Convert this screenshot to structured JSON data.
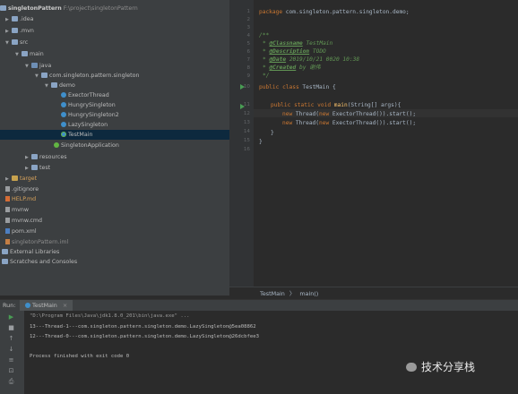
{
  "project_tree": {
    "root_name": "singletonPattern",
    "root_path": "F:\\project\\singletonPattern",
    "items": [
      {
        "label": ".idea",
        "icon": "folder-icon"
      },
      {
        "label": ".mvn",
        "icon": "folder-icon"
      },
      {
        "label": "src",
        "icon": "folder-icon"
      },
      {
        "label": "main",
        "icon": "folder-icon"
      },
      {
        "label": "java",
        "icon": "source-folder-icon"
      },
      {
        "label": "com.singleton.pattern.singleton",
        "icon": "package-icon"
      },
      {
        "label": "demo",
        "icon": "package-icon"
      },
      {
        "label": "ExectorThread",
        "icon": "class-icon"
      },
      {
        "label": "HungrySingleton",
        "icon": "class-icon"
      },
      {
        "label": "HungrySingleton2",
        "icon": "class-icon"
      },
      {
        "label": "LazySingleton",
        "icon": "class-icon"
      },
      {
        "label": "TestMain",
        "icon": "class-icon"
      },
      {
        "label": "SingletonApplication",
        "icon": "spring-class-icon"
      },
      {
        "label": "resources",
        "icon": "folder-icon"
      },
      {
        "label": "test",
        "icon": "folder-icon"
      },
      {
        "label": "target",
        "icon": "excluded-folder-icon"
      },
      {
        "label": ".gitignore",
        "icon": "gitignore-icon"
      },
      {
        "label": "HELP.md",
        "icon": "markdown-icon"
      },
      {
        "label": "mvnw",
        "icon": "file-icon"
      },
      {
        "label": "mvnw.cmd",
        "icon": "file-icon"
      },
      {
        "label": "pom.xml",
        "icon": "maven-icon"
      },
      {
        "label": "singletonPattern.iml",
        "icon": "iml-icon"
      },
      {
        "label": "External Libraries",
        "icon": "library-icon"
      },
      {
        "label": "Scratches and Consoles",
        "icon": "scratch-icon"
      }
    ]
  },
  "editor": {
    "line_numbers": [
      "1",
      "2",
      "3",
      "4",
      "5",
      "6",
      "7",
      "8",
      "9",
      "10",
      "11",
      "12",
      "13",
      "14",
      "15",
      "16"
    ],
    "package_kw": "package",
    "package_name": " com.singleton.pattern.singleton.demo;",
    "doc_open": "/**",
    "doc_classname_tag": "@Classname",
    "doc_classname_val": " TestMain",
    "doc_desc_tag": "@Description",
    "doc_desc_val": " TODO",
    "doc_date_tag": "@Date",
    "doc_date_val": " 2019/10/21 0020 10:38",
    "doc_created_tag": "@Created",
    "doc_created_val": " by 谢伟",
    "doc_close": "*/",
    "class_kw": "public class",
    "class_rest": " TestMain {",
    "method_kw": "public static void",
    "method_name": " main",
    "method_rest": "(String[] args){",
    "stmt1_kw": "new",
    "stmt1_a": " Thread(",
    "stmt1_new": "new",
    "stmt1_b": " ExectorThread()).start();",
    "stmt2_kw": "new",
    "stmt2_a": " Thread(",
    "stmt2_new": "new",
    "stmt2_b": " ExectorThread()).start();",
    "brace_close": "}",
    "class_close": "}"
  },
  "breadcrumb": {
    "class": "TestMain",
    "separator": "〉",
    "method": "main()"
  },
  "run_panel": {
    "label": "Run:",
    "tab_label": "TestMain",
    "close_icon": "×",
    "lines": [
      "\"D:\\Program Files\\Java\\jdk1.8.0_201\\bin\\java.exe\" ...",
      "13---Thread-1---com.singleton.pattern.singleton.demo.LazySingleton@5ea08862",
      "12---Thread-0---com.singleton.pattern.singleton.demo.LazySingleton@26dcbfee3",
      "",
      "Process finished with exit code 0"
    ]
  },
  "watermark": {
    "text": "技术分享栈",
    "icon": "wechat-icon"
  },
  "colors": {
    "editor_bg": "#2b2b2b",
    "panel_bg": "#3c3f41",
    "selected": "#0d293e",
    "keyword": "#cc7832",
    "doc": "#629755"
  }
}
